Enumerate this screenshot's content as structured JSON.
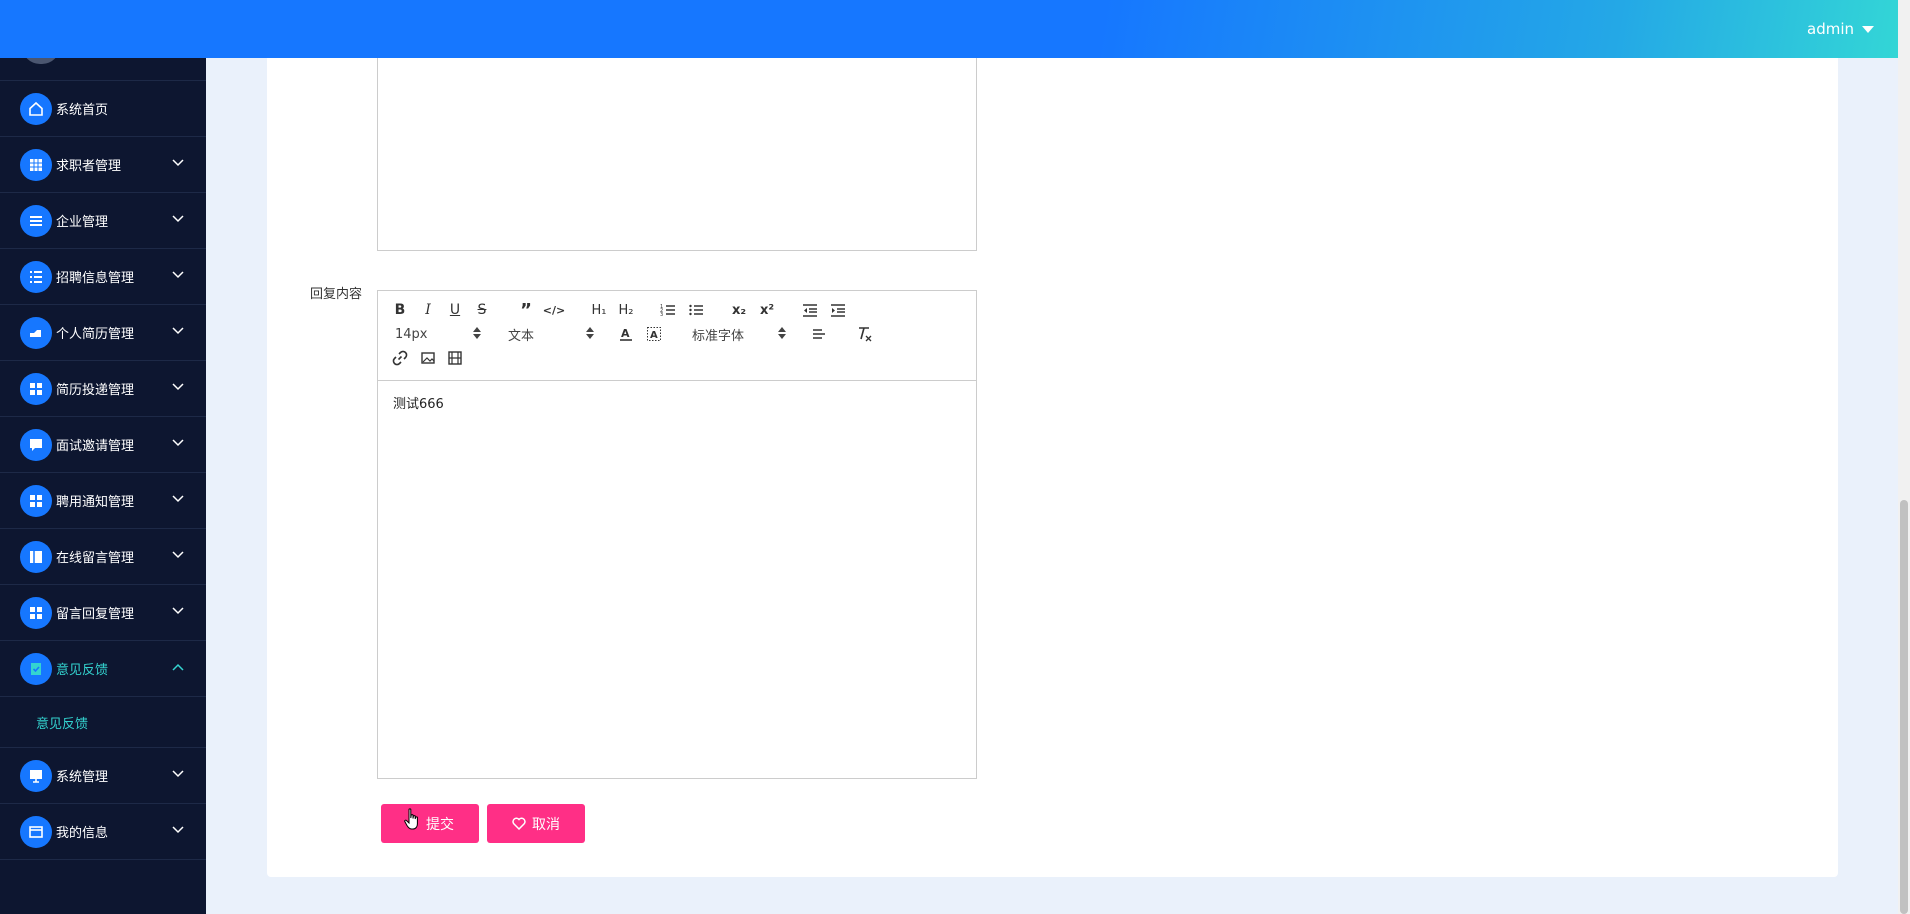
{
  "header": {
    "username": "admin"
  },
  "sidebar": {
    "items": [
      {
        "label": "系统首页",
        "icon": "home-icon",
        "expandable": false
      },
      {
        "label": "求职者管理",
        "icon": "grid-icon",
        "expandable": true
      },
      {
        "label": "企业管理",
        "icon": "list-icon",
        "expandable": true
      },
      {
        "label": "招聘信息管理",
        "icon": "list-icon",
        "expandable": true
      },
      {
        "label": "个人简历管理",
        "icon": "hand-icon",
        "expandable": true
      },
      {
        "label": "简历投递管理",
        "icon": "apps-icon",
        "expandable": true
      },
      {
        "label": "面试邀请管理",
        "icon": "chat-icon",
        "expandable": true
      },
      {
        "label": "聘用通知管理",
        "icon": "apps-icon",
        "expandable": true
      },
      {
        "label": "在线留言管理",
        "icon": "book-icon",
        "expandable": true
      },
      {
        "label": "留言回复管理",
        "icon": "apps-icon",
        "expandable": true
      },
      {
        "label": "意见反馈",
        "icon": "clipboard-check-icon",
        "expandable": true,
        "active": true
      },
      {
        "label": "系统管理",
        "icon": "monitor-icon",
        "expandable": true
      },
      {
        "label": "我的信息",
        "icon": "card-icon",
        "expandable": true
      }
    ],
    "submenu": {
      "label": "意见反馈"
    }
  },
  "form": {
    "field_label": "回复内容",
    "editor": {
      "font_size": "14px",
      "header_select": "文本",
      "font_family": "标准字体",
      "content": "测试666"
    },
    "submit_label": "提交",
    "cancel_label": "取消"
  },
  "colors": {
    "primary": "#1677ff",
    "accent": "#ff2f86",
    "sidebar_bg": "#0d1630",
    "active_text": "#34d4d0"
  }
}
